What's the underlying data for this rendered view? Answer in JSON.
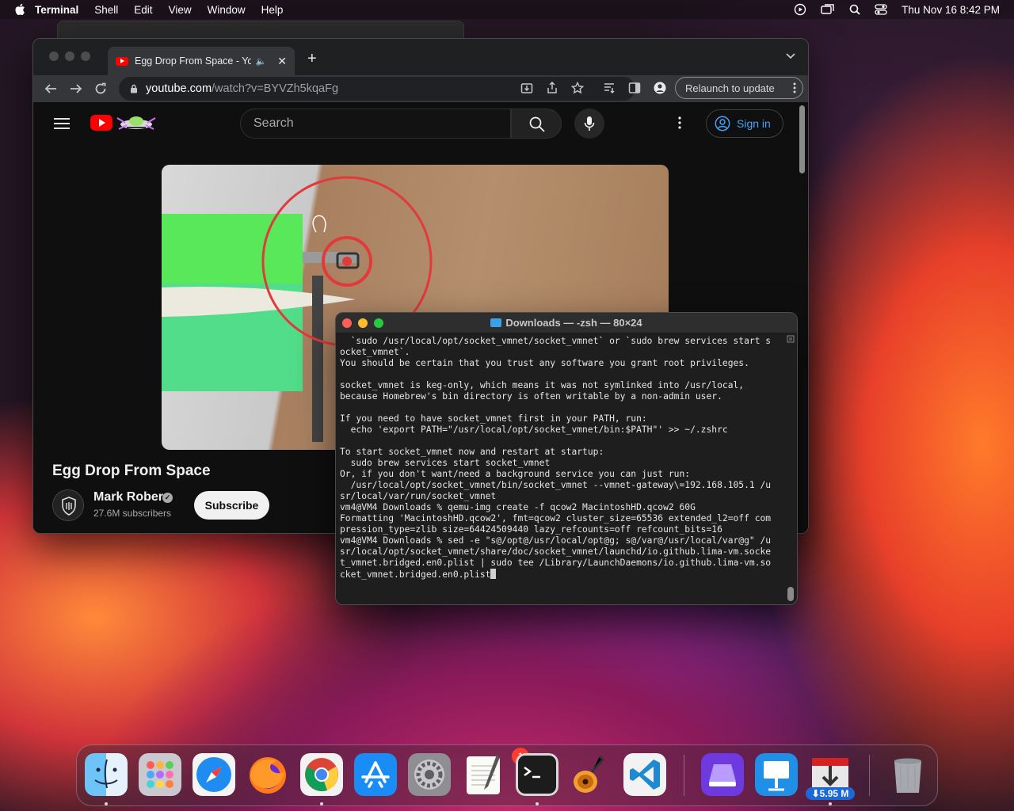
{
  "menubar": {
    "app_name": "Terminal",
    "items": [
      "Shell",
      "Edit",
      "View",
      "Window",
      "Help"
    ],
    "datetime": "Thu Nov 16  8:42 PM"
  },
  "chrome": {
    "tab_title": "Egg Drop From Space - YouTube",
    "new_tab": "+",
    "url_host": "youtube.com",
    "url_path": "/watch?v=BYVZh5kqaFg",
    "relaunch_label": "Relaunch to update"
  },
  "youtube": {
    "search_placeholder": "Search",
    "sign_in": "Sign in",
    "video_title": "Egg Drop From Space",
    "channel_name": "Mark Rober",
    "subscribers": "27.6M subscribers",
    "subscribe_label": "Subscribe",
    "colors": {
      "accent": "#ff0000",
      "link": "#3ea6ff"
    }
  },
  "terminal": {
    "title": "Downloads — -zsh — 80×24",
    "lines": [
      "  `sudo /usr/local/opt/socket_vmnet/socket_vmnet` or `sudo brew services start s",
      "ocket_vmnet`.",
      "You should be certain that you trust any software you grant root privileges.",
      "",
      "socket_vmnet is keg-only, which means it was not symlinked into /usr/local,",
      "because Homebrew's bin directory is often writable by a non-admin user.",
      "",
      "If you need to have socket_vmnet first in your PATH, run:",
      "  echo 'export PATH=\"/usr/local/opt/socket_vmnet/bin:$PATH\"' >> ~/.zshrc",
      "",
      "To start socket_vmnet now and restart at startup:",
      "  sudo brew services start socket_vmnet",
      "Or, if you don't want/need a background service you can just run:",
      "  /usr/local/opt/socket_vmnet/bin/socket_vmnet --vmnet-gateway\\=192.168.105.1 /u",
      "sr/local/var/run/socket_vmnet",
      "vm4@VM4 Downloads % qemu-img create -f qcow2 MacintoshHD.qcow2 60G",
      "Formatting 'MacintoshHD.qcow2', fmt=qcow2 cluster_size=65536 extended_l2=off com",
      "pression_type=zlib size=64424509440 lazy_refcounts=off refcount_bits=16",
      "vm4@VM4 Downloads % sed -e \"s@/opt@/usr/local/opt@g; s@/var@/usr/local/var@g\" /u",
      "sr/local/opt/socket_vmnet/share/doc/socket_vmnet/launchd/io.github.lima-vm.socke",
      "t_vmnet.bridged.en0.plist | sudo tee /Library/LaunchDaemons/io.github.lima-vm.so",
      "cket_vmnet.bridged.en0.plist"
    ]
  },
  "dock": {
    "apps": [
      "Finder",
      "Launchpad",
      "Safari",
      "Firefox",
      "Google Chrome",
      "App Store",
      "System Settings",
      "TextEdit",
      "Terminal",
      "GarageBand",
      "Visual Studio Code",
      "Apple Configurator",
      "Keynote",
      "Downloads",
      "Trash"
    ],
    "settings_badge": "1",
    "download_label": "⬇5.95 M"
  }
}
